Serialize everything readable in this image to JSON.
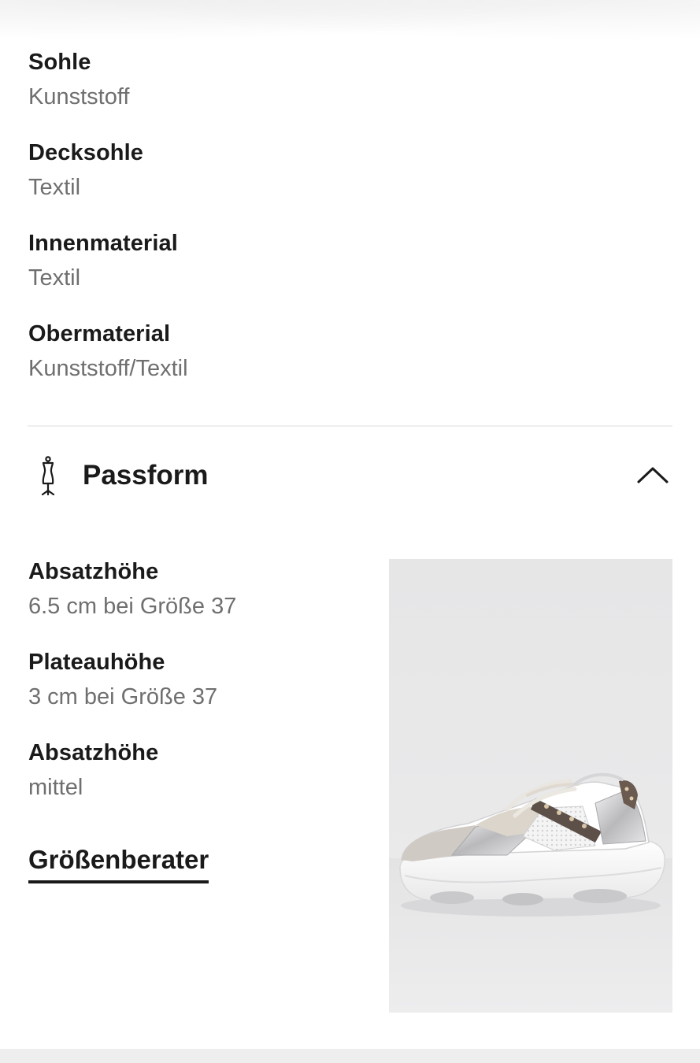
{
  "material": [
    {
      "label": "Sohle",
      "value": "Kunststoff"
    },
    {
      "label": "Decksohle",
      "value": "Textil"
    },
    {
      "label": "Innenmaterial",
      "value": "Textil"
    },
    {
      "label": "Obermaterial",
      "value": "Kunststoff/Textil"
    }
  ],
  "passform": {
    "title": "Passform",
    "icon": "mannequin-icon",
    "toggle_icon": "chevron-up-icon",
    "expanded": true,
    "attributes": [
      {
        "label": "Absatzhöhe",
        "value": "6.5 cm bei Größe 37"
      },
      {
        "label": "Plateauhöhe",
        "value": "3 cm bei Größe 37"
      },
      {
        "label": "Absatzhöhe",
        "value": "mittel"
      }
    ],
    "size_advisor_label": "Größenberater",
    "image": "sneaker-product-image"
  }
}
